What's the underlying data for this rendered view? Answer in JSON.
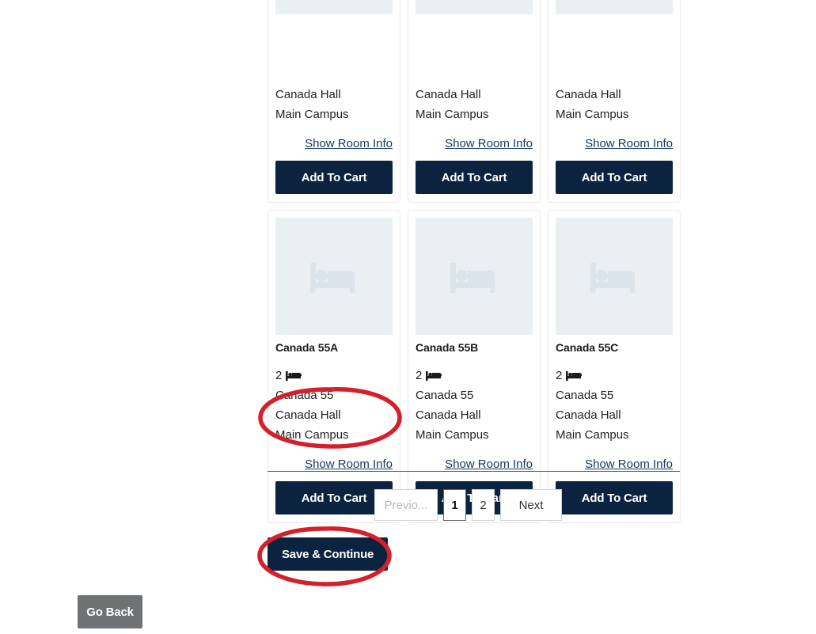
{
  "page": {
    "background_color": "#ffffff",
    "accent_navy": "#0c2340",
    "link_color": "#163864",
    "annotation_color": "#d32030",
    "gray_button_color": "#6e7275"
  },
  "cards": {
    "row_top_partial": [
      {
        "hall": "Canada Hall",
        "campus": "Main Campus",
        "show_room_info": "Show Room Info",
        "add_to_cart": "Add To Cart"
      },
      {
        "hall": "Canada Hall",
        "campus": "Main Campus",
        "show_room_info": "Show Room Info",
        "add_to_cart": "Add To Cart"
      },
      {
        "hall": "Canada Hall",
        "campus": "Main Campus",
        "show_room_info": "Show Room Info",
        "add_to_cart": "Add To Cart"
      }
    ],
    "row_bottom": [
      {
        "image_icon": "bed-placeholder-icon",
        "title": "Canada 55A",
        "bed_count": "2",
        "bed_icon": "bed-icon",
        "room": "Canada 55",
        "hall": "Canada Hall",
        "campus": "Main Campus",
        "show_room_info": "Show Room Info",
        "add_to_cart": "Add To Cart",
        "annotated": true
      },
      {
        "image_icon": "bed-placeholder-icon",
        "title": "Canada 55B",
        "bed_count": "2",
        "bed_icon": "bed-icon",
        "room": "Canada 55",
        "hall": "Canada Hall",
        "campus": "Main Campus",
        "show_room_info": "Show Room Info",
        "add_to_cart": "Add To Cart",
        "annotated": false
      },
      {
        "image_icon": "bed-placeholder-icon",
        "title": "Canada 55C",
        "bed_count": "2",
        "bed_icon": "bed-icon",
        "room": "Canada 55",
        "hall": "Canada Hall",
        "campus": "Main Campus",
        "show_room_info": "Show Room Info",
        "add_to_cart": "Add To Cart",
        "annotated": false
      }
    ]
  },
  "pagination": {
    "previous_label": "Previo...",
    "previous_disabled": true,
    "pages": [
      "1",
      "2"
    ],
    "current_page": "1",
    "next_label": "Next"
  },
  "footer": {
    "save_continue_label": "Save & Continue",
    "go_back_label": "Go Back"
  },
  "annotations": [
    {
      "name": "highlight-add-to-cart-55a",
      "target": "add-to-cart-55a"
    },
    {
      "name": "highlight-save-continue",
      "target": "save-continue-button"
    }
  ]
}
